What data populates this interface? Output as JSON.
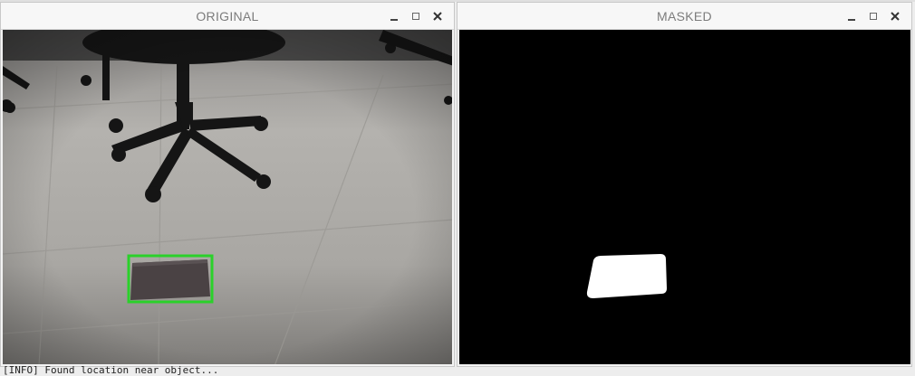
{
  "windows": {
    "original": {
      "title": "ORIGINAL"
    },
    "masked": {
      "title": "MASKED"
    }
  },
  "controls": {
    "minimize": "minimize-icon",
    "maximize": "maximize-icon",
    "close": "close-icon"
  },
  "detection": {
    "box_color": "#2ad12a",
    "mask_color": "#ffffff"
  },
  "terminal": {
    "line": "[INFO] Found location near object..."
  }
}
